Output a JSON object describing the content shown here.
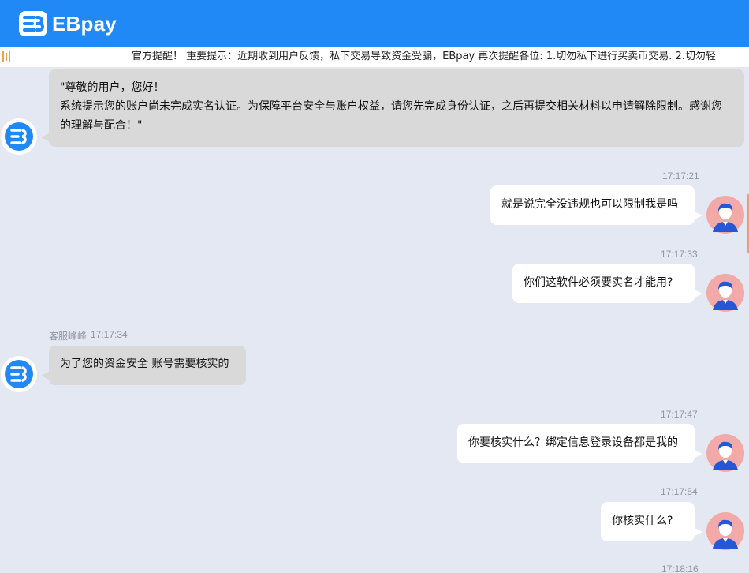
{
  "header": {
    "brand": "EBpay",
    "brand_color": "#2089f6"
  },
  "notice": {
    "text": "官方提醒！ 重要提示：近期收到用户反馈，私下交易导致资金受骗，EBpay 再次提醒各位: 1.切勿私下进行买卖币交易. 2.切勿轻"
  },
  "messages": [
    {
      "side": "agent",
      "lines": [
        "\"尊敬的用户，您好！",
        "系统提示您的账户尚未完成实名认证。为保障平台安全与账户权益，请您先完成身份认证，之后再提交相关材料以申请解除限制。感谢您",
        "的理解与配合！\""
      ]
    },
    {
      "side": "user",
      "time": "17:17:21",
      "text": "就是说完全没违规也可以限制我是吗"
    },
    {
      "side": "user",
      "time": "17:17:33",
      "text": "你们这软件必须要实名才能用?"
    },
    {
      "side": "agent",
      "sender": "客服峰峰",
      "time": "17:17:34",
      "text": "为了您的资金安全 账号需要核实的"
    },
    {
      "side": "user",
      "time": "17:17:47",
      "text": "你要核实什么？绑定信息登录设备都是我的"
    },
    {
      "side": "user",
      "time": "17:17:54",
      "text": "你核实什么?"
    },
    {
      "side": "user",
      "time": "17:18:16",
      "text": ""
    }
  ]
}
